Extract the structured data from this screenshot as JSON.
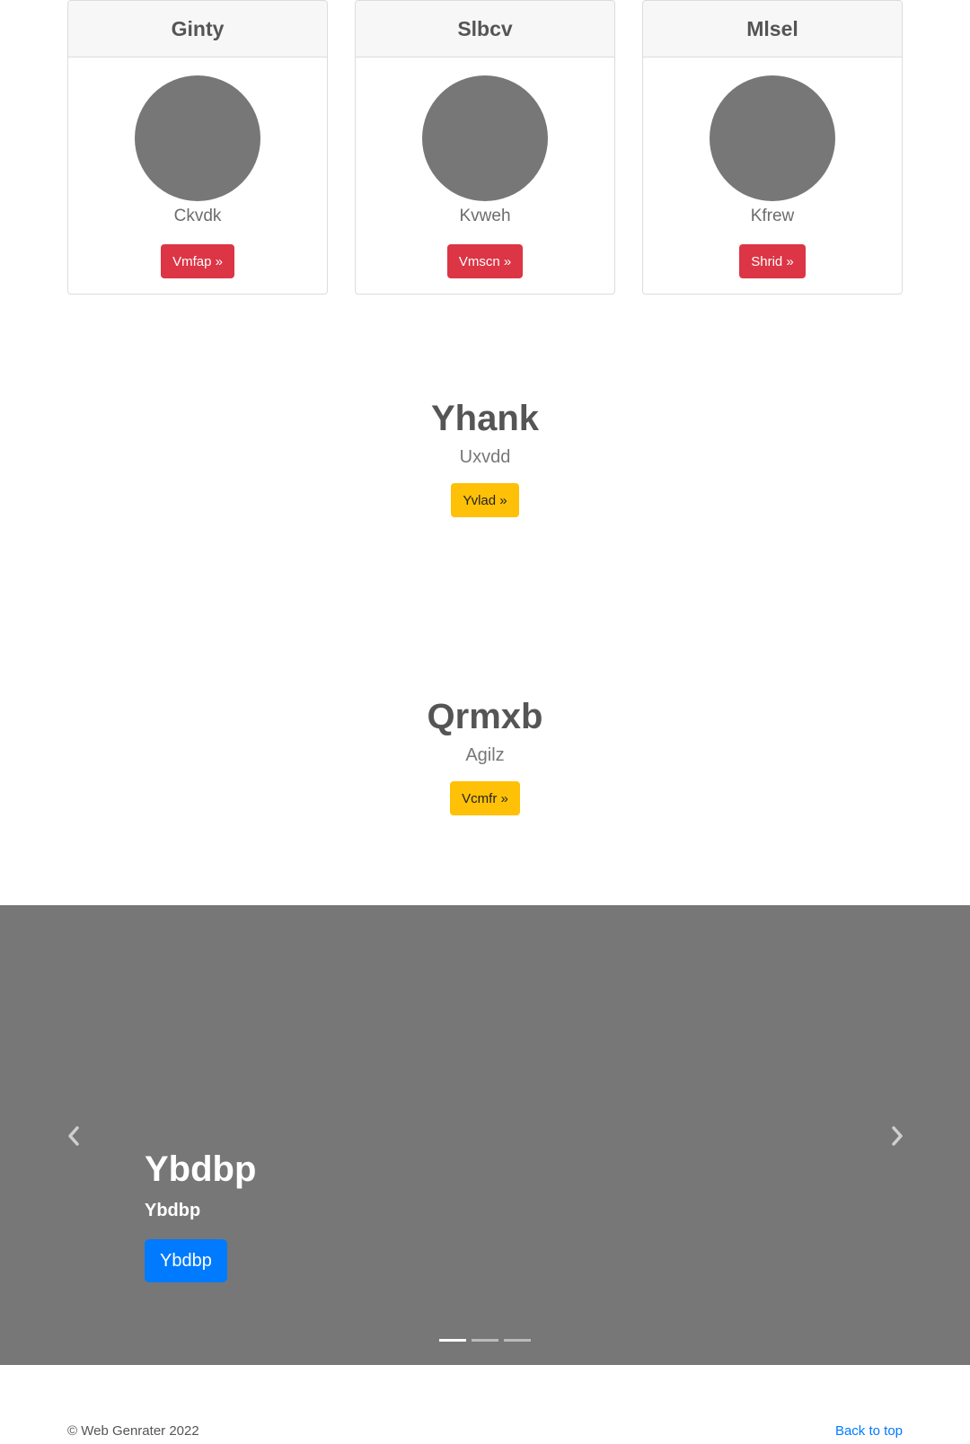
{
  "cards": [
    {
      "title": "Ginty",
      "text": "Ckvdk",
      "button": "Vmfap »"
    },
    {
      "title": "Slbcv",
      "text": "Kvweh",
      "button": "Vmscn »"
    },
    {
      "title": "Mlsel",
      "text": "Kfrew",
      "button": "Shrid »"
    }
  ],
  "features": [
    {
      "heading": "Yhank",
      "text": "Uxvdd",
      "button": "Yvlad »"
    },
    {
      "heading": "Qrmxb",
      "text": "Agilz",
      "button": "Vcmfr »"
    }
  ],
  "carousel": {
    "heading": "Ybdbp",
    "subtext": "Ybdbp",
    "button": "Ybdbp",
    "slide_count": 3,
    "active_slide": 1
  },
  "footer": {
    "copyright": "© Web Genrater 2022",
    "back_to_top": "Back to top"
  },
  "colors": {
    "danger": "#dc3545",
    "warning": "#ffc107",
    "primary": "#007bff",
    "placeholder_gray": "#777777"
  }
}
